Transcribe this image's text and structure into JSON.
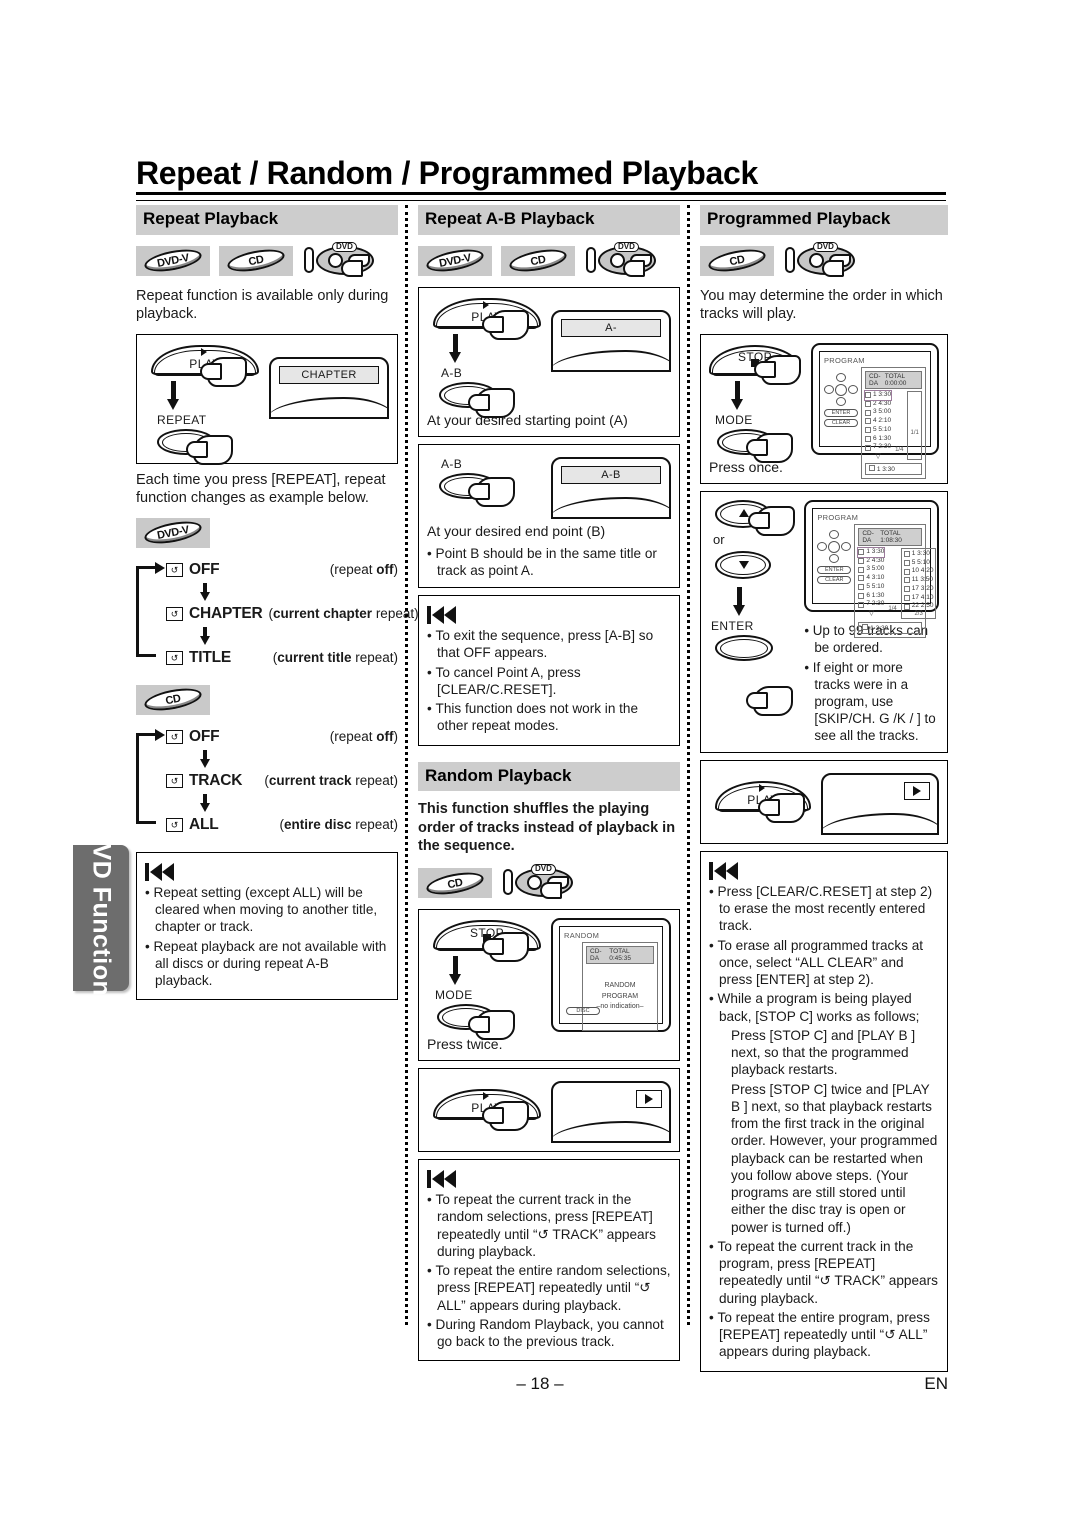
{
  "document": {
    "page_title": "Repeat / Random / Programmed Playback",
    "side_tab": "DVD Functions",
    "footer_page": "– 18 –",
    "footer_lang": "EN"
  },
  "badges": {
    "dvdv": "DVD-V",
    "cd": "CD",
    "dvd_wand": "DVD"
  },
  "columns": {
    "repeat": {
      "heading": "Repeat Playback",
      "intro": "Repeat function is available only during playback.",
      "figure": {
        "play_label": "PLAY",
        "repeat_label": "REPEAT",
        "osd_text": "CHAPTER"
      },
      "after_figure": "Each time you press [REPEAT], repeat function changes as example below.",
      "after_figure_kbd": "[REPEAT]",
      "cycle_dvd": {
        "badge": "DVD-V",
        "items": [
          {
            "icon": "repeat-icon",
            "name": "OFF",
            "desc_plain_pre": "(repeat ",
            "desc_bold": "off",
            "desc_plain_post": ")"
          },
          {
            "icon": "repeat-icon",
            "name": "CHAPTER",
            "desc_plain_pre": "(",
            "desc_bold": "current chapter",
            "desc_plain_post": " repeat)"
          },
          {
            "icon": "repeat-icon",
            "name": "TITLE",
            "desc_plain_pre": "(",
            "desc_bold": "current title",
            "desc_plain_post": " repeat)"
          }
        ]
      },
      "cycle_cd": {
        "badge": "CD",
        "items": [
          {
            "icon": "repeat-icon",
            "name": "OFF",
            "desc_plain_pre": "(repeat ",
            "desc_bold": "off",
            "desc_plain_post": ")"
          },
          {
            "icon": "repeat-icon",
            "name": "TRACK",
            "desc_plain_pre": "(",
            "desc_bold": "current track",
            "desc_plain_post": " repeat)"
          },
          {
            "icon": "repeat-icon",
            "name": "ALL",
            "desc_plain_pre": "(",
            "desc_bold": "entire disc",
            "desc_plain_post": " repeat)"
          }
        ]
      },
      "notes": [
        "Repeat setting (except ALL) will be cleared when moving to another title, chapter or track.",
        "Repeat playback are not available with all discs or during repeat A-B playback."
      ]
    },
    "repeat_ab": {
      "heading": "Repeat A-B Playback",
      "step1": {
        "play_label": "PLAY",
        "ab_label": "A-B",
        "osd_text": "A-",
        "caption": "At your desired starting point (A)"
      },
      "step2": {
        "ab_label": "A-B",
        "osd_text": "A-B",
        "caption": "At your desired end point (B)",
        "bullet": "Point B should be in the same title or track as point A."
      },
      "notes": [
        "To exit the sequence, press [A-B] so that OFF appears.",
        "To cancel Point A, press [CLEAR/C.RESET].",
        "This function does not work in the other repeat modes."
      ]
    },
    "random": {
      "heading": "Random Playback",
      "intro": "This function shuffles the playing order of tracks instead of playback in the sequence.",
      "step1": {
        "stop_label": "STOP",
        "mode_label": "MODE",
        "caption": "Press twice.",
        "osd": {
          "title": "RANDOM",
          "disc_type": "CD-DA",
          "total": "TOTAL 0:45:35",
          "line1": "RANDOM PROGRAM",
          "line2": "–no indication–",
          "button": "DISC"
        }
      },
      "step2": {
        "play_label": "PLAY",
        "play_icon": "play-icon"
      },
      "notes": [
        "To repeat the current track in the random selections, press [REPEAT] repeatedly until “↺ TRACK” appears during playback.",
        "To repeat the entire random selections, press [REPEAT] repeatedly until “↺ ALL” appears during playback.",
        "During Random Playback, you cannot go back to the previous track."
      ]
    },
    "programmed": {
      "heading": "Programmed Playback",
      "intro": "You may determine the order in which tracks will play.",
      "step1": {
        "stop_label": "STOP",
        "mode_label": "MODE",
        "caption": "Press once.",
        "osd": {
          "title": "PROGRAM",
          "disc_type": "CD-DA",
          "total": "TOTAL 0:00:00",
          "tracks": [
            "1  3:30",
            "2  4:30",
            "3  5:00",
            "4  2:10",
            "5  5:10",
            "6  1:30",
            "7  2:30"
          ],
          "page_indicator": "1/4",
          "right_indicator": "1/1",
          "footer": "1  3:30",
          "enter_label": "ENTER",
          "clear_label": "CLEAR"
        }
      },
      "step2": {
        "or_label": "or",
        "enter_label": "ENTER",
        "up_icon": "arrow-up-icon",
        "down_icon": "arrow-down-icon",
        "osd": {
          "title": "PROGRAM",
          "disc_type": "CD-DA",
          "total": "TOTAL 1:08:30",
          "tracks_left": [
            "1  3:30",
            "2  4:30",
            "3  5:00",
            "4  3:10",
            "5  5:10",
            "6  1:30",
            "7  2:30"
          ],
          "tracks_right": [
            "1   3:30",
            "5   5:10",
            "10  4:20",
            "11  3:50",
            "17  3:20",
            "17  4:10",
            "22  2:50"
          ],
          "page_indicator": "1/4",
          "right_indicator": "2/3",
          "footer": "1  3:30"
        },
        "bullets": [
          "Up to 99 tracks can be ordered.",
          "If eight or more tracks were in a program, use [SKIP/CH. G  /K     /  ] to see all the tracks."
        ]
      },
      "step3": {
        "play_label": "PLAY",
        "play_icon": "play-icon"
      },
      "notes": [
        "Press [CLEAR/C.RESET] at step 2) to erase the most recently entered track.",
        "To erase all programmed tracks at once, select “ALL CLEAR” and press [ENTER] at step 2).",
        "While a program is being played back, [STOP C] works as follows;"
      ],
      "notes_sub": [
        "Press [STOP C] and [PLAY B ] next, so that the programmed playback restarts.",
        "Press [STOP C] twice and [PLAY B ] next, so that playback restarts from the first track in the original order. However, your programmed playback can be restarted when you follow above steps. (Your programs are still stored until either the disc tray is open or power is turned off.)"
      ],
      "notes_tail": [
        "To repeat the current track in the program, press [REPEAT] repeatedly until “↺ TRACK” appears during playback.",
        "To repeat the entire program, press [REPEAT] repeatedly until “↺ ALL” appears during playback."
      ]
    }
  }
}
